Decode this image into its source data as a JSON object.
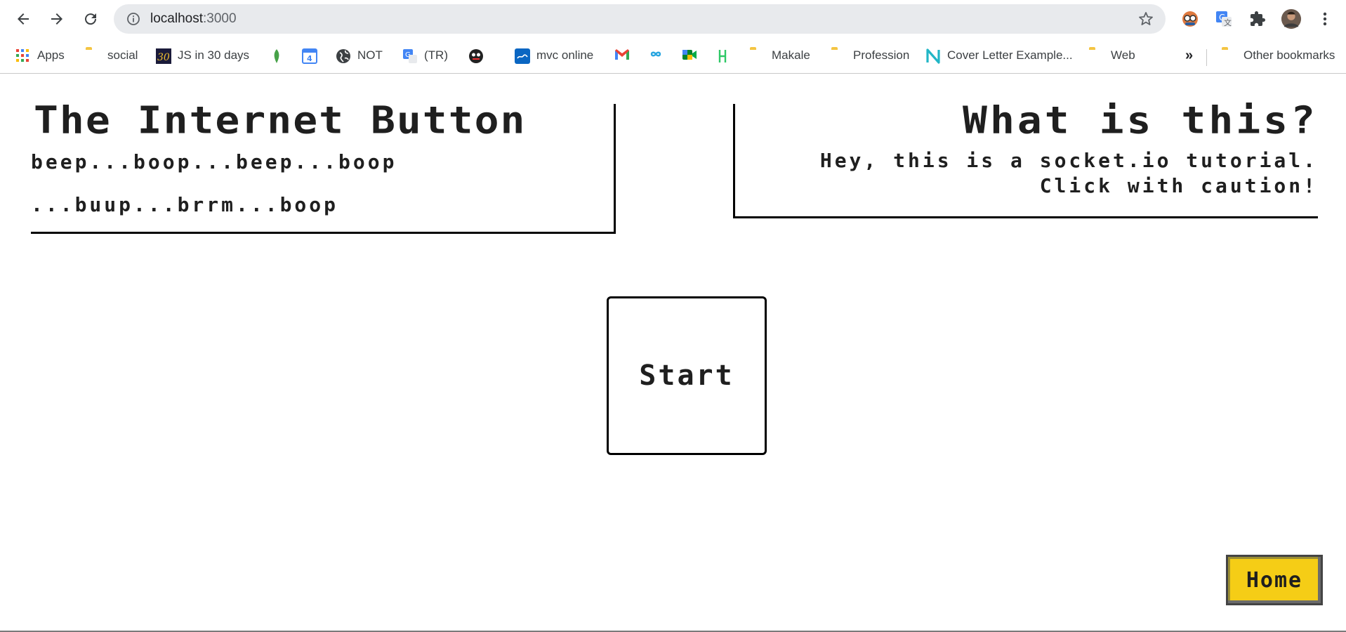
{
  "browser": {
    "url_host": "localhost",
    "url_port": ":3000",
    "bookmarks": {
      "apps": "Apps",
      "social": "social",
      "js30": "JS in 30 days",
      "not": "NOT",
      "tr": "(TR)",
      "mvc": "mvc online",
      "makale": "Makale",
      "profession": "Profession",
      "cover_letter": "Cover Letter Example...",
      "web": "Web",
      "overflow": "»",
      "other": "Other bookmarks"
    },
    "icons": [
      "back-arrow-icon",
      "forward-arrow-icon",
      "reload-icon",
      "info-icon",
      "star-icon",
      "extension-icon",
      "translate-icon",
      "puzzle-icon",
      "profile-avatar",
      "kebab-menu-icon"
    ]
  },
  "page": {
    "left_panel": {
      "title": "The Internet Button",
      "line1": "beep...boop...beep...boop",
      "line2": "...buup...brrm...boop"
    },
    "right_panel": {
      "title": "What is this?",
      "line1": "Hey, this is a socket.io tutorial.",
      "line2": "Click with caution!"
    },
    "start_button": "Start",
    "home_button": "Home",
    "colors": {
      "home_bg": "#f5cd16",
      "text": "#1f1f1f",
      "border": "#000000"
    }
  }
}
